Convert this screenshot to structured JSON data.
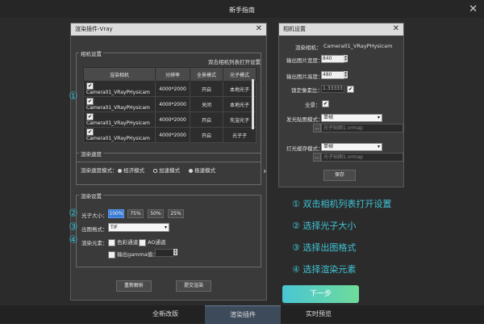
{
  "app": {
    "title": "新手指南",
    "close": "✕"
  },
  "vray_dialog": {
    "title": "渲染插件-Vray",
    "close": "✕",
    "camera_group": {
      "label": "相机设置",
      "hint": "双击相机列表打开设置",
      "columns": [
        "渲染相机",
        "分辨率",
        "全景模式",
        "光子模式"
      ],
      "rows": [
        {
          "check": "✔",
          "name": "Camera01_VRayPHysicam",
          "res": "4000*2000",
          "pano": "开启",
          "photon": "本地光子"
        },
        {
          "check": "✔",
          "name": "Camera01_VRayPHysicam",
          "res": "4000*2000",
          "pano": "关闭",
          "photon": "本地光子"
        },
        {
          "check": "✔",
          "name": "Camera01_VRayPHysicam",
          "res": "4000*2000",
          "pano": "开启",
          "photon": "先渲光子"
        },
        {
          "check": "✔",
          "name": "Camera01_VRayPHysicam",
          "res": "4000*2000",
          "pano": "开启",
          "photon": "光子子"
        }
      ]
    },
    "speed_group": {
      "label": "渲染速度",
      "mode_label": "渲染速度模式：",
      "options": [
        "经济模式",
        "加速模式",
        "极速模式"
      ],
      "selected": 1
    },
    "render_group": {
      "label": "渲染设置",
      "photon_size_label": "光子大小：",
      "photon_sizes": [
        "100%",
        "75%",
        "50%",
        "25%"
      ],
      "photon_selected": 0,
      "format_label": "出图格式：",
      "format_value": "TIF",
      "elements_label": "渲染元素：",
      "channel_color": "色彩通道",
      "channel_ao": "AO通道",
      "gamma_label": "输出gamma值："
    },
    "reparse_button": "重新解析",
    "submit_button": "提交渲染",
    "markers": [
      "①",
      "②",
      "③",
      "④"
    ]
  },
  "camera_dialog": {
    "title": "相机设置",
    "close": "✕",
    "camera_label": "渲染相机：",
    "camera_value": "Camera01_VRayPHysicam",
    "width_label": "输出图片宽度：",
    "width_value": "840",
    "height_label": "输出图片高度：",
    "height_value": "480",
    "ratio_label": "锁定像素比：",
    "ratio_value": "1.33333",
    "pano_label": "全景：",
    "photon_map_label": "发光贴图模式：",
    "photon_map_mode": "单帧",
    "photon_map_file": "光子贴图1.vrmap",
    "light_cache_label": "灯光缓存模式：",
    "light_cache_mode": "单帧",
    "light_cache_file": "光子贴图1.vrmap",
    "save_button": "保存",
    "check": "✔",
    "browse": "..."
  },
  "steps": [
    {
      "num": "①",
      "text": "双击相机列表打开设置"
    },
    {
      "num": "②",
      "text": "选择光子大小"
    },
    {
      "num": "③",
      "text": "选择出图格式"
    },
    {
      "num": "④",
      "text": "选择渲染元素"
    }
  ],
  "next_button": "下一步",
  "expand_arrow": "›",
  "tabs": [
    "全新改版",
    "渲染插件",
    "实时预览"
  ],
  "active_tab": 1,
  "colors": {
    "accent": "#2fb8c9",
    "selected_button": "#3a7bd5"
  }
}
